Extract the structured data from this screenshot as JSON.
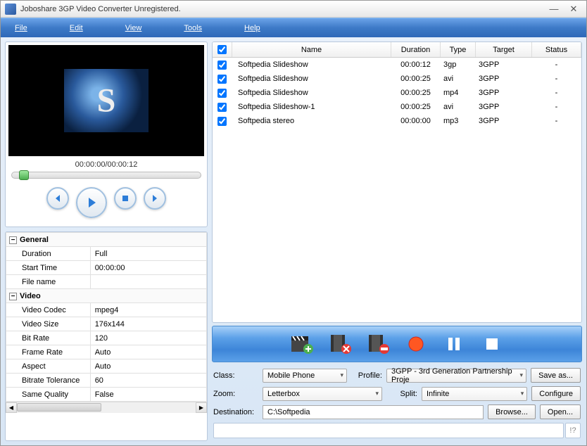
{
  "title": "Joboshare 3GP Video Converter Unregistered.",
  "menu": [
    "File",
    "Edit",
    "View",
    "Tools",
    "Help"
  ],
  "player": {
    "time": "00:00:00/00:00:12"
  },
  "grid": {
    "headers": {
      "name": "Name",
      "duration": "Duration",
      "type": "Type",
      "target": "Target",
      "status": "Status"
    },
    "rows": [
      {
        "name": "Softpedia Slideshow",
        "duration": "00:00:12",
        "type": "3gp",
        "target": "3GPP",
        "status": "-"
      },
      {
        "name": "Softpedia Slideshow",
        "duration": "00:00:25",
        "type": "avi",
        "target": "3GPP",
        "status": "-"
      },
      {
        "name": "Softpedia Slideshow",
        "duration": "00:00:25",
        "type": "mp4",
        "target": "3GPP",
        "status": "-"
      },
      {
        "name": "Softpedia Slideshow-1",
        "duration": "00:00:25",
        "type": "avi",
        "target": "3GPP",
        "status": "-"
      },
      {
        "name": "Softpedia stereo",
        "duration": "00:00:00",
        "type": "mp3",
        "target": "3GPP",
        "status": "-"
      }
    ]
  },
  "props": {
    "groups": [
      {
        "label": "General",
        "items": [
          {
            "k": "Duration",
            "v": "Full"
          },
          {
            "k": "Start Time",
            "v": "00:00:00"
          },
          {
            "k": "File name",
            "v": ""
          }
        ]
      },
      {
        "label": "Video",
        "items": [
          {
            "k": "Video Codec",
            "v": "mpeg4"
          },
          {
            "k": "Video Size",
            "v": "176x144"
          },
          {
            "k": "Bit Rate",
            "v": "120"
          },
          {
            "k": "Frame Rate",
            "v": "Auto"
          },
          {
            "k": "Aspect",
            "v": "Auto"
          },
          {
            "k": "Bitrate Tolerance",
            "v": "60"
          },
          {
            "k": "Same Quality",
            "v": "False"
          }
        ]
      }
    ]
  },
  "controls": {
    "classLabel": "Class:",
    "classValue": "Mobile Phone",
    "profileLabel": "Profile:",
    "profileValue": "3GPP - 3rd Generation Partnership Proje",
    "saveAs": "Save as...",
    "zoomLabel": "Zoom:",
    "zoomValue": "Letterbox",
    "splitLabel": "Split:",
    "splitValue": "Infinite",
    "configure": "Configure",
    "destLabel": "Destination:",
    "destValue": "C:\\Softpedia",
    "browse": "Browse...",
    "open": "Open..."
  },
  "statusGrip": "!?"
}
